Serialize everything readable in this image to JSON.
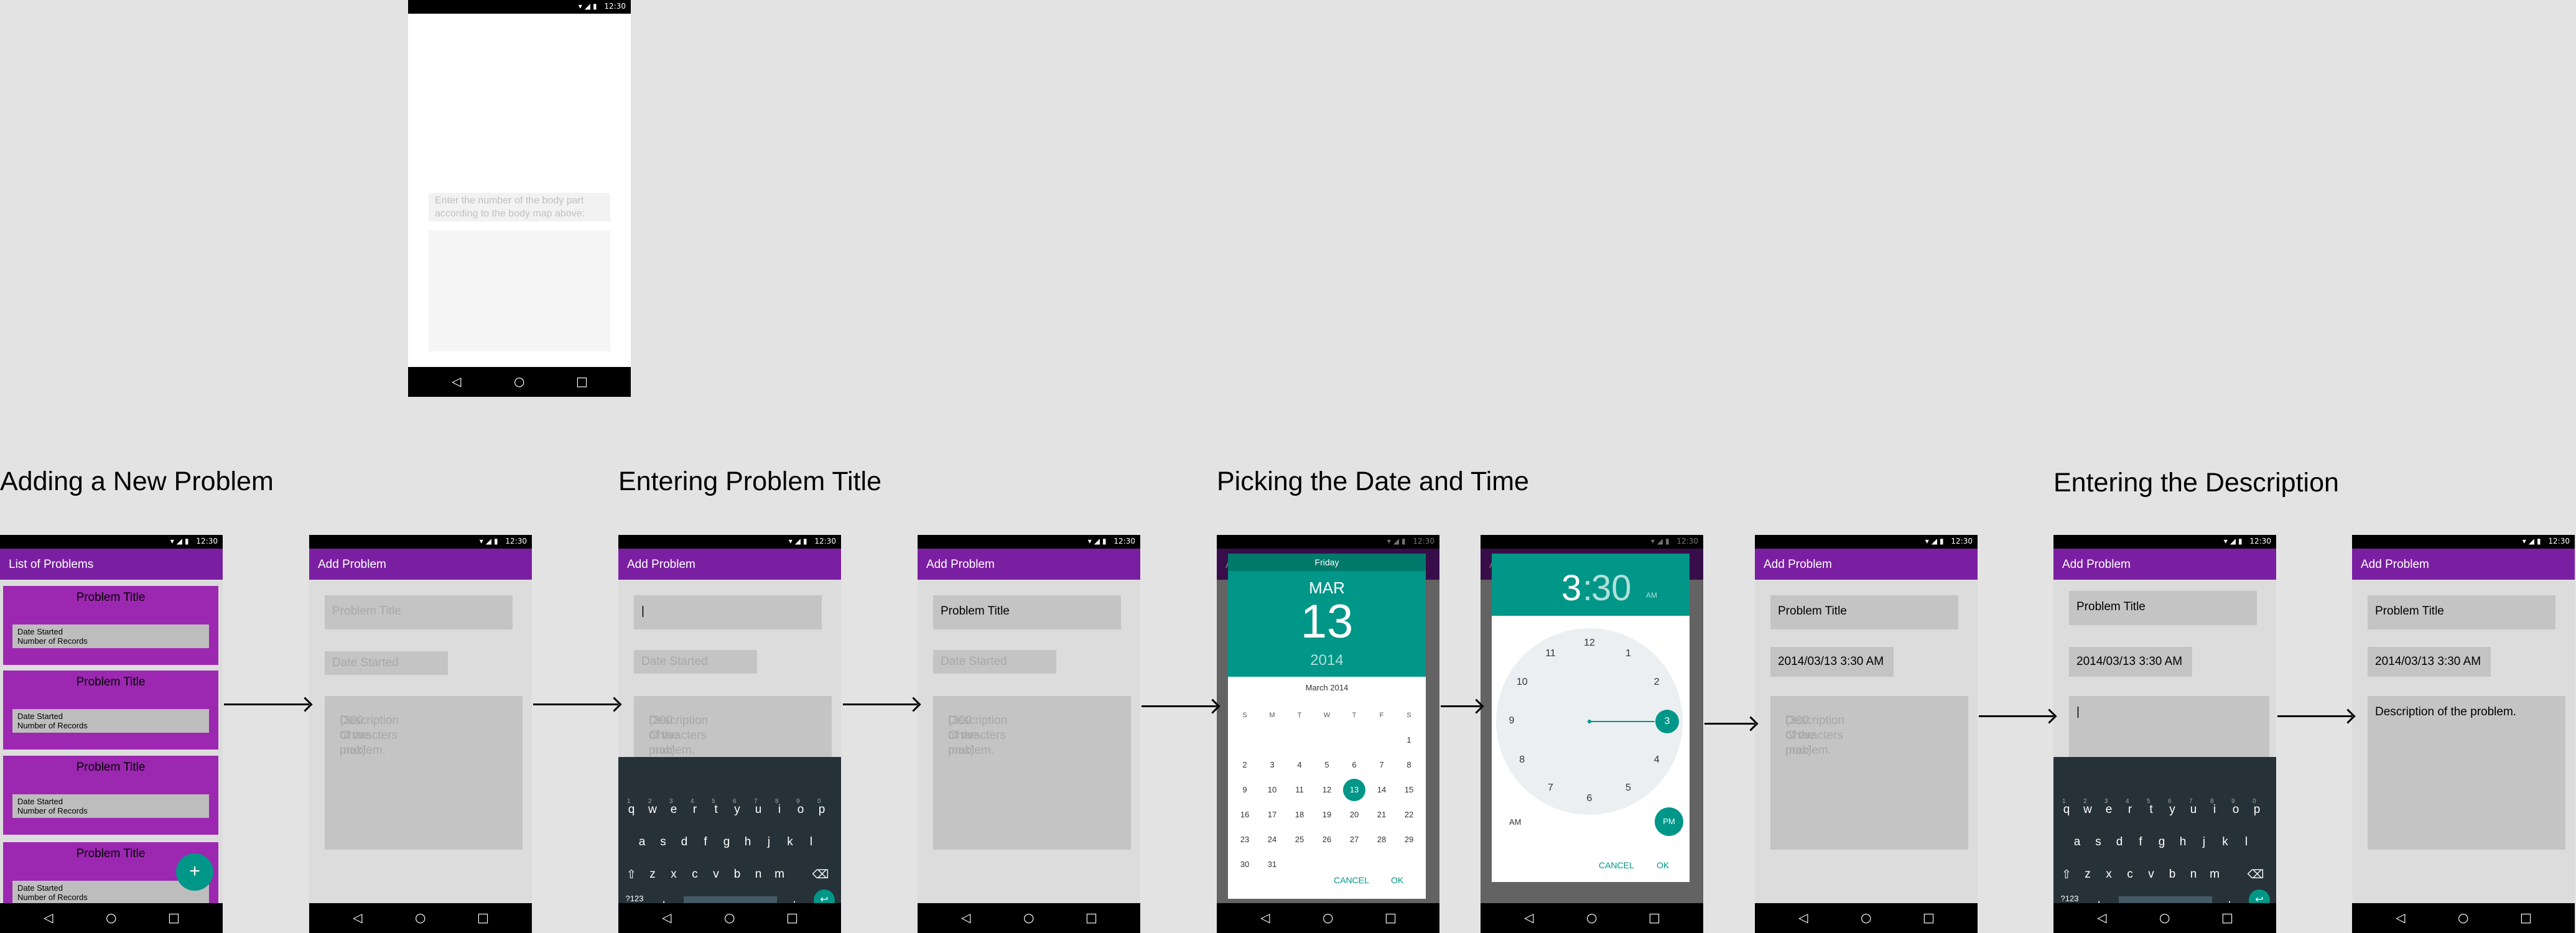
{
  "status_time": "12:30",
  "status_icons": "▾◢▮",
  "nav": {
    "back": "◁",
    "home": "○",
    "recent": "□"
  },
  "headings": {
    "h1": "Adding a New Problem",
    "h2": "Entering Problem Title",
    "h3": "Picking the Date and Time",
    "h4": "Entering the Description"
  },
  "top_phone": {
    "hint": "Enter the number of the body part according to the body map above:"
  },
  "list_screen": {
    "title": "List of Problems",
    "cards": [
      {
        "title": "Problem Title",
        "meta1": "Date Started",
        "meta2": "Number of Records"
      },
      {
        "title": "Problem Title",
        "meta1": "Date Started",
        "meta2": "Number of Records"
      },
      {
        "title": "Problem Title",
        "meta1": "Date Started",
        "meta2": "Number of Records"
      },
      {
        "title": "Problem Title",
        "meta1": "Date Started",
        "meta2": "Number of Records"
      }
    ],
    "fab": "+"
  },
  "add_problem": {
    "title": "Add Problem",
    "title_placeholder": "Problem Title",
    "date_placeholder": "Date Started",
    "desc_placeholder_1": "Description of the problem.",
    "desc_placeholder_2": "(300 Characters max)",
    "title_value": "Problem Title",
    "date_value": "2014/03/13 3:30 AM",
    "desc_value": "Description of the problem.",
    "cursor": "|"
  },
  "keyboard": {
    "row1": [
      "q",
      "w",
      "e",
      "r",
      "t",
      "y",
      "u",
      "i",
      "o",
      "p"
    ],
    "row1_hints": [
      "1",
      "2",
      "3",
      "4",
      "5",
      "6",
      "7",
      "8",
      "9",
      "0"
    ],
    "row2": [
      "a",
      "s",
      "d",
      "f",
      "g",
      "h",
      "j",
      "k",
      "l"
    ],
    "row3": [
      "z",
      "x",
      "c",
      "v",
      "b",
      "n",
      "m"
    ],
    "shift": "⇧",
    "backspace": "⌫",
    "sym": "?123",
    "comma": ",",
    "period": ".",
    "enter": "↩"
  },
  "date_picker": {
    "weekday": "Friday",
    "month": "MAR",
    "day": "13",
    "year": "2014",
    "month_label": "March 2014",
    "dow": [
      "S",
      "M",
      "T",
      "W",
      "T",
      "F",
      "S"
    ],
    "weeks": [
      [
        "",
        "",
        "",
        "",
        "",
        "",
        "1"
      ],
      [
        "2",
        "3",
        "4",
        "5",
        "6",
        "7",
        "8"
      ],
      [
        "9",
        "10",
        "11",
        "12",
        "13",
        "14",
        "15"
      ],
      [
        "16",
        "17",
        "18",
        "19",
        "20",
        "21",
        "22"
      ],
      [
        "23",
        "24",
        "25",
        "26",
        "27",
        "28",
        "29"
      ],
      [
        "30",
        "31",
        "",
        "",
        "",
        "",
        ""
      ]
    ],
    "cancel": "CANCEL",
    "ok": "OK"
  },
  "time_picker": {
    "hour": "3",
    "colon": ":",
    "minute": "30",
    "ampm_header": "AM",
    "numbers": [
      "12",
      "1",
      "2",
      "3",
      "4",
      "5",
      "6",
      "7",
      "8",
      "9",
      "10",
      "11"
    ],
    "am": "AM",
    "pm": "PM",
    "cancel": "CANCEL",
    "ok": "OK"
  }
}
